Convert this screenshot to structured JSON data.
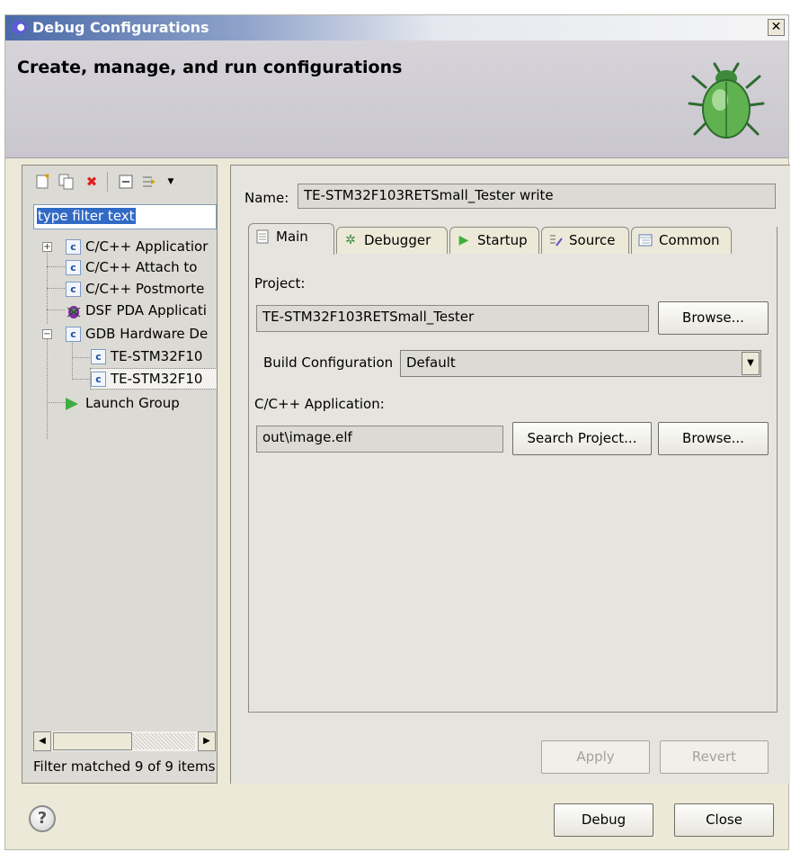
{
  "window": {
    "title": "Debug Configurations",
    "close_glyph": "✕"
  },
  "banner": {
    "heading": "Create, manage, and run configurations"
  },
  "left": {
    "toolbar_icons": [
      "new-configuration-icon",
      "duplicate-icon",
      "delete-icon",
      "collapse-all-icon",
      "filter-icon",
      "dropdown-arrow-icon"
    ],
    "filter_text": "type filter text",
    "tree": [
      {
        "label": "C/C++ Applicatior",
        "icon": "c-icon",
        "expander": "+"
      },
      {
        "label": "C/C++ Attach to",
        "icon": "c-icon"
      },
      {
        "label": "C/C++ Postmorte",
        "icon": "c-icon"
      },
      {
        "label": "DSF PDA Applicati",
        "icon": "bug-icon"
      },
      {
        "label": "GDB Hardware De",
        "icon": "c-icon",
        "expander": "−"
      },
      {
        "label": "TE-STM32F10",
        "icon": "c-icon"
      },
      {
        "label": "TE-STM32F10",
        "icon": "c-icon"
      },
      {
        "label": "Launch Group",
        "icon": "launch-arrow-icon"
      }
    ],
    "status": "Filter matched 9 of 9 items"
  },
  "right": {
    "name_label": "Name:",
    "name_value": "TE-STM32F103RETSmall_Tester write",
    "tabs": [
      {
        "label": "Main",
        "icon": "page-icon"
      },
      {
        "label": "Debugger",
        "icon": "debugger-icon"
      },
      {
        "label": "Startup",
        "icon": "play-icon"
      },
      {
        "label": "Source",
        "icon": "source-icon"
      },
      {
        "label": "Common",
        "icon": "common-icon"
      }
    ],
    "project_label": "Project:",
    "project_value": "TE-STM32F103RETSmall_Tester",
    "browse_label": "Browse...",
    "build_config_label": "Build Configuration",
    "build_config_value": "Default",
    "app_label": "C/C++ Application:",
    "app_value": "out\\image.elf",
    "search_project_label": "Search Project...",
    "browse2_label": "Browse...",
    "apply_label": "Apply",
    "revert_label": "Revert"
  },
  "bottom": {
    "help_glyph": "?",
    "debug_label": "Debug",
    "close_label": "Close"
  }
}
